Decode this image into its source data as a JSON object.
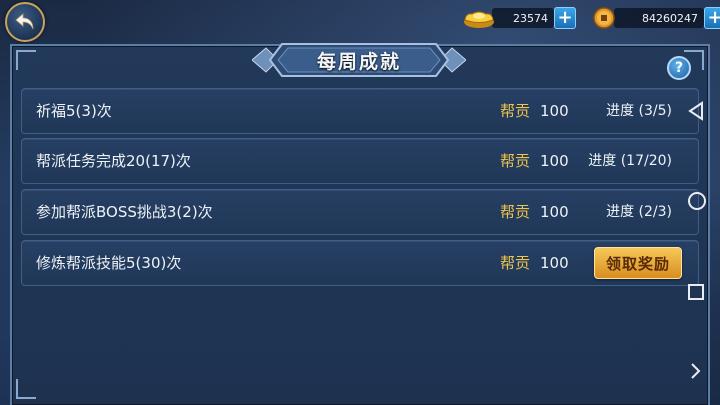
{
  "header": {
    "title": "每周成就"
  },
  "currency": {
    "gold": {
      "icon": "gold-ingot-icon",
      "value": "23574"
    },
    "coin": {
      "icon": "copper-coin-icon",
      "value": "84260247"
    },
    "plus_label": "+"
  },
  "help_label": "?",
  "rows": [
    {
      "name": "祈福5(3)次",
      "reward_label": "帮贡",
      "reward_value": "100",
      "progress": "进度 (3/5)"
    },
    {
      "name": "帮派任务完成20(17)次",
      "reward_label": "帮贡",
      "reward_value": "100",
      "progress": "进度 (17/20)"
    },
    {
      "name": "参加帮派BOSS挑战3(2)次",
      "reward_label": "帮贡",
      "reward_value": "100",
      "progress": "进度 (2/3)"
    },
    {
      "name": "修炼帮派技能5(30)次",
      "reward_label": "帮贡",
      "reward_value": "100",
      "claim_label": "领取奖励"
    }
  ],
  "colors": {
    "accent_gold": "#f0c44a",
    "claim_button": "#e8a83a",
    "panel_bg": "#22395a"
  }
}
